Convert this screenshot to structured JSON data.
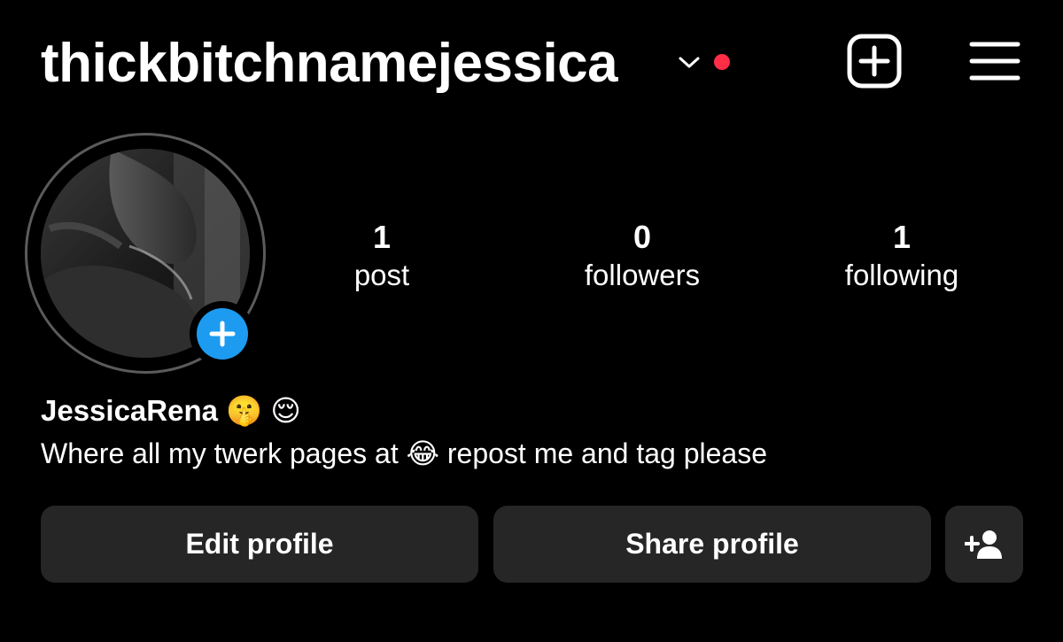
{
  "header": {
    "username": "thickbitchnamejessica",
    "accent_notification": "#ff2d46"
  },
  "icons": {
    "chevron": "chevron-down-icon",
    "new_post": "plus-square-icon",
    "menu": "hamburger-menu-icon",
    "add_story": "plus-circle-icon",
    "add_user": "person-add-icon"
  },
  "stats": [
    {
      "value": "1",
      "label": "post"
    },
    {
      "value": "0",
      "label": "followers"
    },
    {
      "value": "1",
      "label": "following"
    }
  ],
  "profile": {
    "display_name": "JessicaRena 🤫 😌",
    "bio": "Where all my twerk pages at 😂 repost me and tag please"
  },
  "actions": {
    "edit_label": "Edit profile",
    "share_label": "Share profile"
  },
  "colors": {
    "background": "#000000",
    "button_bg": "#262626",
    "add_story_blue": "#1d9bf0"
  }
}
